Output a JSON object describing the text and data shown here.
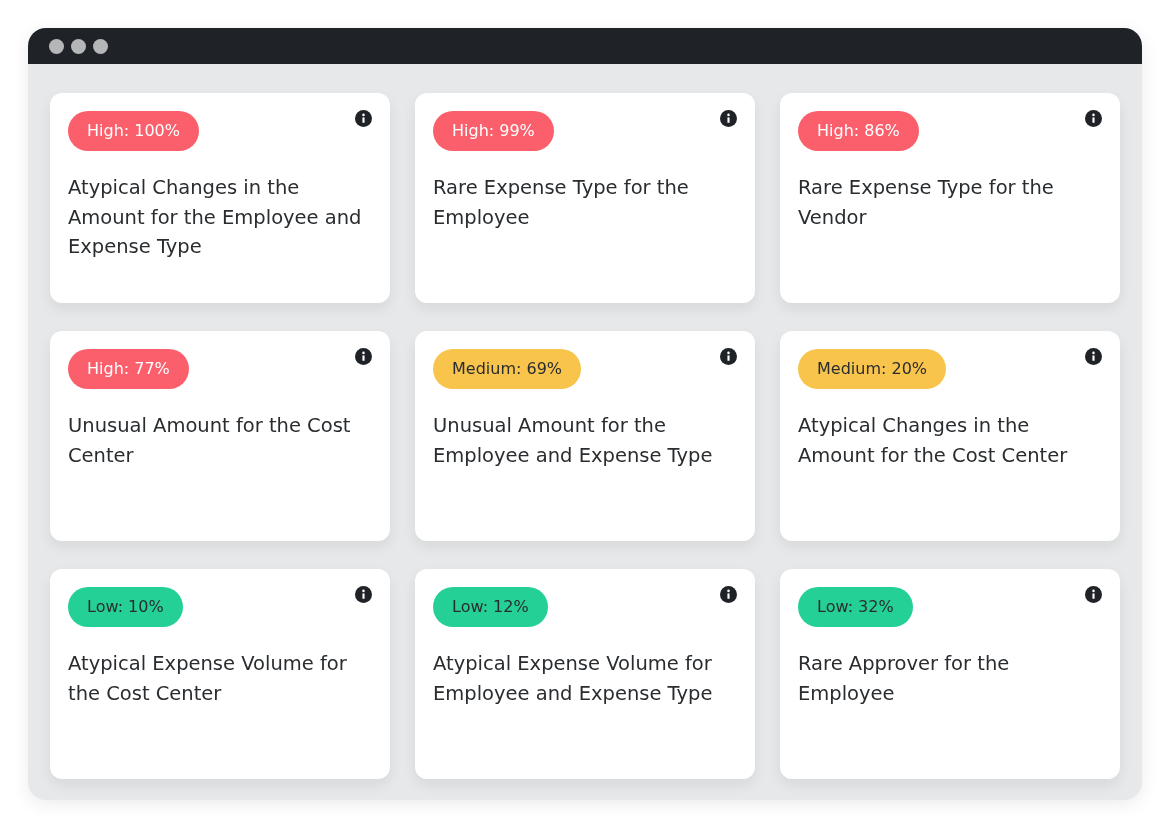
{
  "cards": [
    {
      "badge": {
        "kind": "high",
        "label": "High: 100%"
      },
      "title": "Atypical Changes in the Amount for the Employee and Expense Type"
    },
    {
      "badge": {
        "kind": "high",
        "label": "High: 99%"
      },
      "title": "Rare Expense Type for the Employee"
    },
    {
      "badge": {
        "kind": "high",
        "label": "High: 86%"
      },
      "title": "Rare Expense Type for the Vendor"
    },
    {
      "badge": {
        "kind": "high",
        "label": "High: 77%"
      },
      "title": "Unusual Amount for the Cost Center"
    },
    {
      "badge": {
        "kind": "medium",
        "label": "Medium: 69%"
      },
      "title": "Unusual Amount for the Employee and Expense Type"
    },
    {
      "badge": {
        "kind": "medium",
        "label": "Medium: 20%"
      },
      "title": "Atypical Changes in the Amount for the Cost Center"
    },
    {
      "badge": {
        "kind": "low",
        "label": "Low: 10%"
      },
      "title": "Atypical Expense Volume for the Cost Center"
    },
    {
      "badge": {
        "kind": "low",
        "label": "Low: 12%"
      },
      "title": "Atypical Expense Volume for Employee and Expense Type"
    },
    {
      "badge": {
        "kind": "low",
        "label": "Low: 32%"
      },
      "title": "Rare Approver for the Employee"
    }
  ]
}
